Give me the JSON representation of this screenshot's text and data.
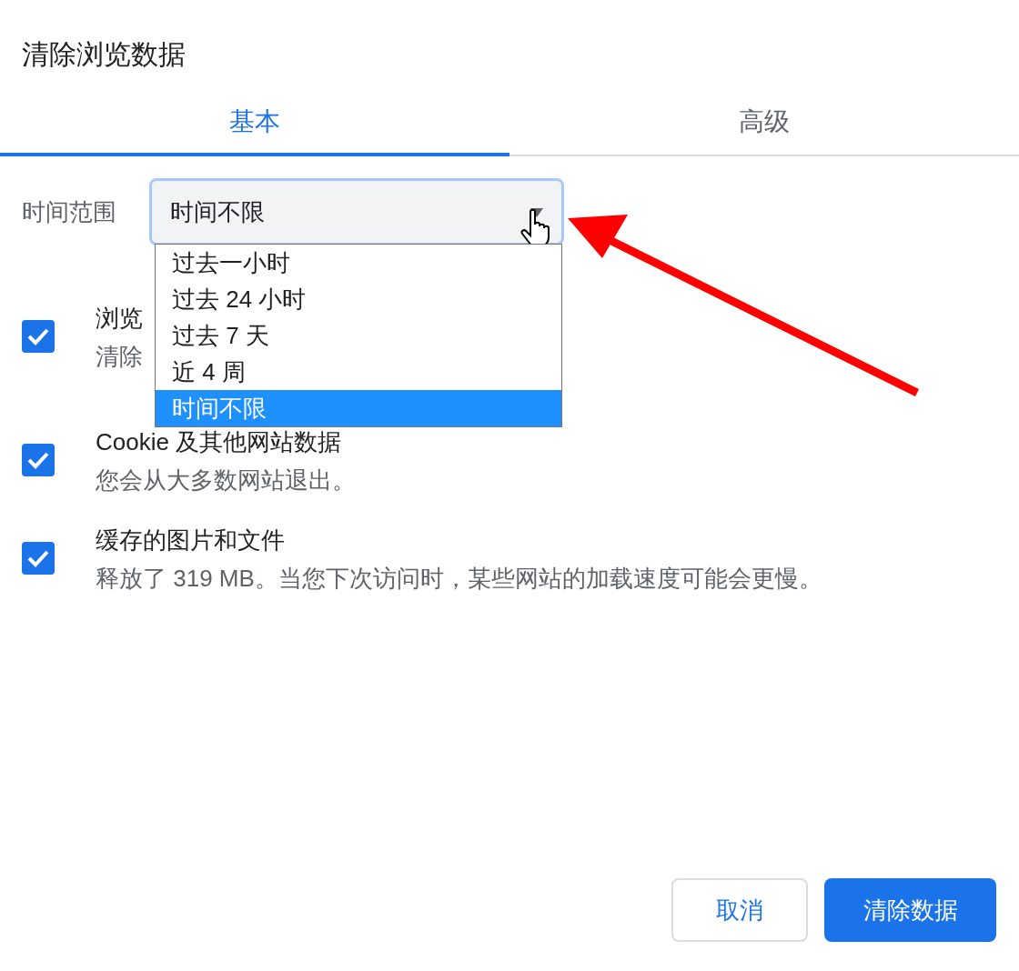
{
  "dialog": {
    "title": "清除浏览数据"
  },
  "tabs": [
    {
      "label": "基本",
      "selected": true
    },
    {
      "label": "高级",
      "selected": false
    }
  ],
  "time_range": {
    "label": "时间范围",
    "value": "时间不限",
    "expanded": true,
    "options": [
      {
        "label": "过去一小时",
        "selected": false
      },
      {
        "label": "过去 24 小时",
        "selected": false
      },
      {
        "label": "过去 7 天",
        "selected": false
      },
      {
        "label": "近 4 周",
        "selected": false
      },
      {
        "label": "时间不限",
        "selected": true
      }
    ]
  },
  "items": [
    {
      "title": "浏览",
      "description": "清除",
      "checked": true
    },
    {
      "title": "Cookie 及其他网站数据",
      "description": "您会从大多数网站退出。",
      "checked": true
    },
    {
      "title": "缓存的图片和文件",
      "description": "释放了 319 MB。当您下次访问时，某些网站的加载速度可能会更慢。",
      "checked": true
    }
  ],
  "buttons": [
    {
      "label": "取消",
      "kind": "secondary"
    },
    {
      "label": "清除数据",
      "kind": "primary"
    }
  ]
}
